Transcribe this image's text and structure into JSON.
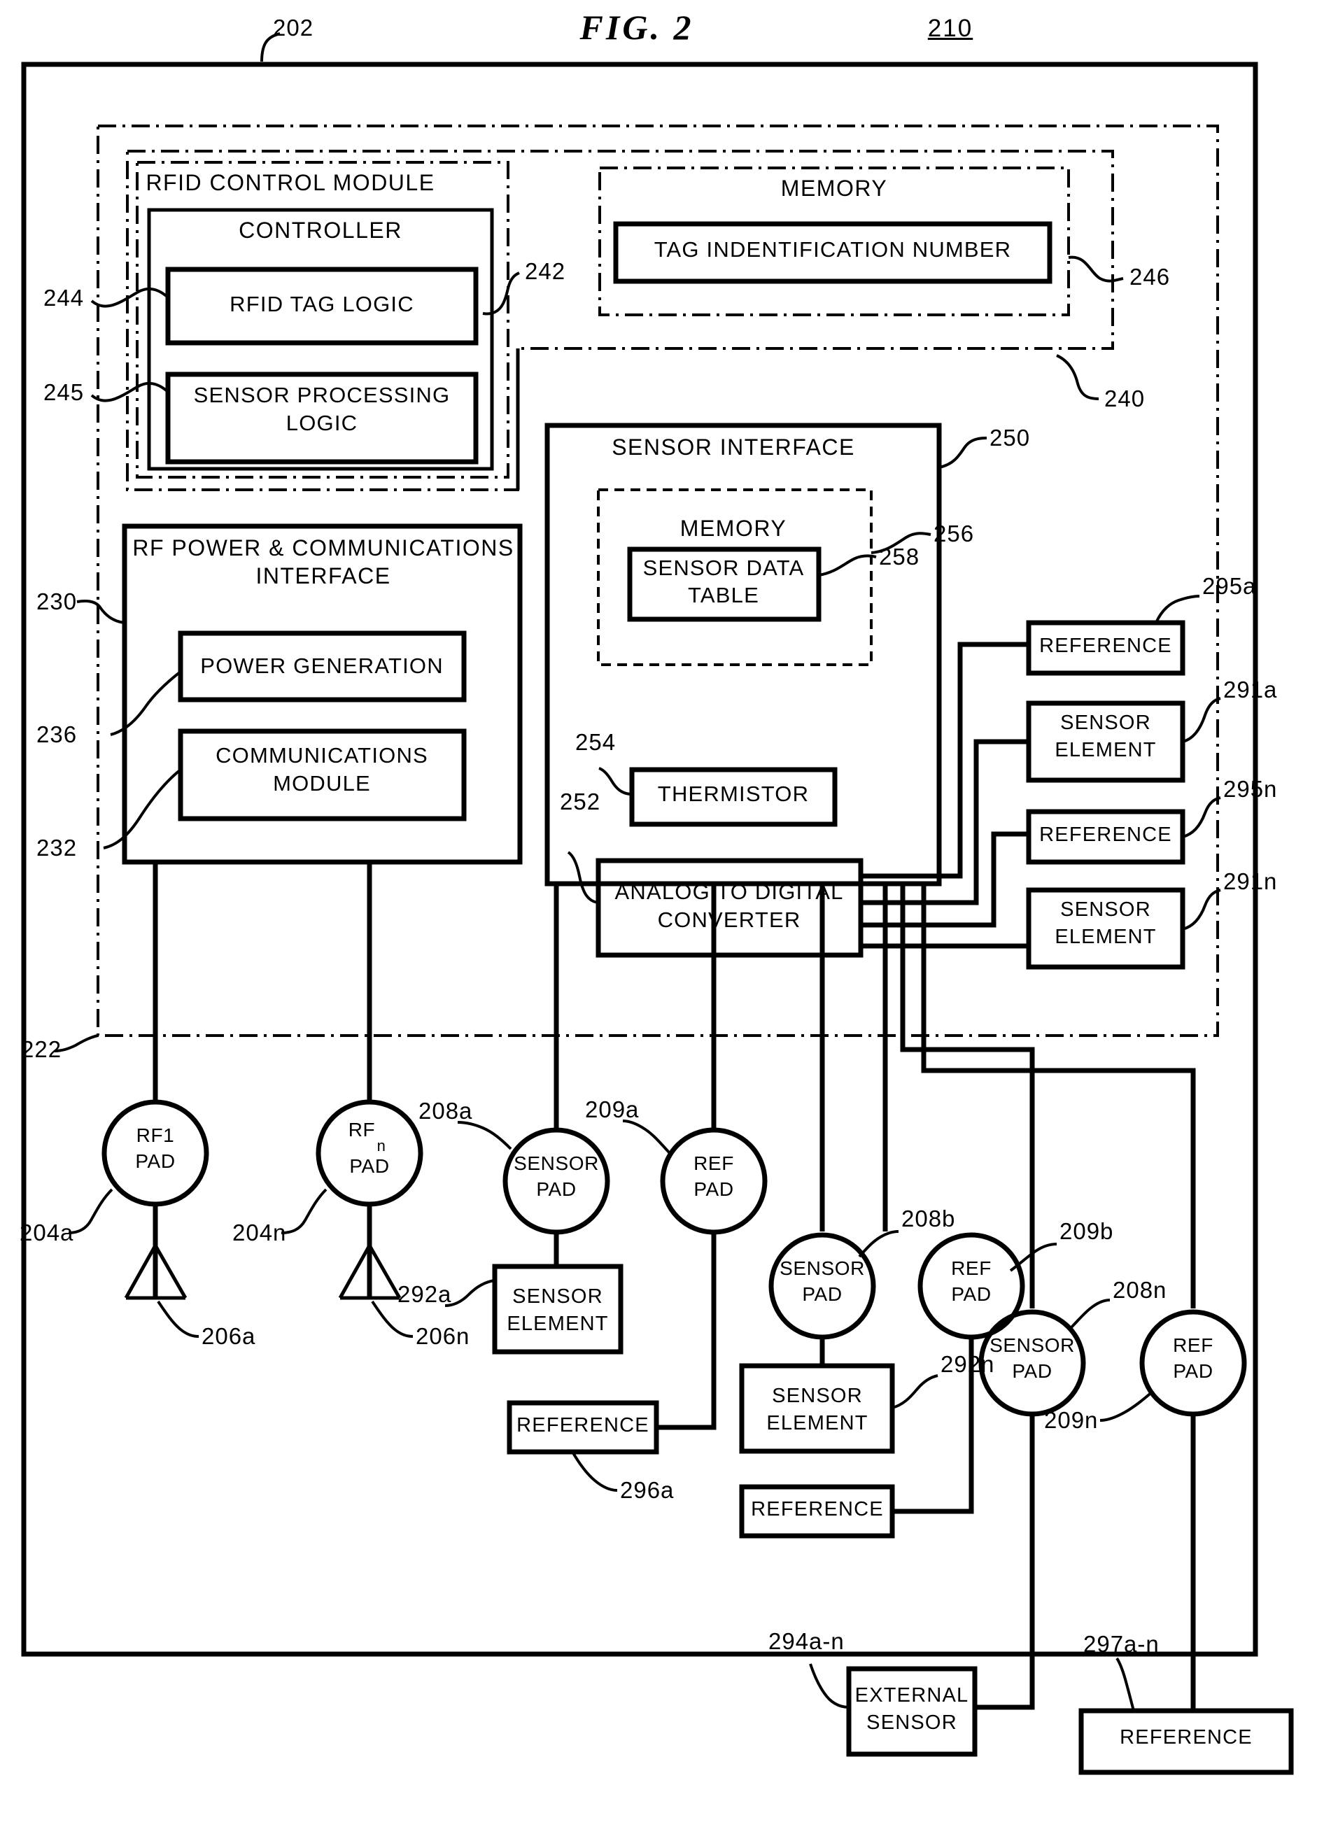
{
  "figure": {
    "title": "FIG. 2",
    "assembly_ref": "210",
    "outer_ref": "202"
  },
  "refs": {
    "r202": "202",
    "r210": "210",
    "r222": "222",
    "r230": "230",
    "r232": "232",
    "r236": "236",
    "r240": "240",
    "r242": "242",
    "r244": "244",
    "r245": "245",
    "r246": "246",
    "r250": "250",
    "r252": "252",
    "r254": "254",
    "r256": "256",
    "r258": "258",
    "r204a": "204a",
    "r204n": "204n",
    "r206a": "206a",
    "r206n": "206n",
    "r208a": "208a",
    "r208b": "208b",
    "r208n": "208n",
    "r209a": "209a",
    "r209b": "209b",
    "r209n": "209n",
    "r291a": "291a",
    "r291n": "291n",
    "r292a": "292a",
    "r292n": "292n",
    "r294an": "294a-n",
    "r295a": "295a",
    "r295n": "295n",
    "r296a": "296a",
    "r297an": "297a-n"
  },
  "blocks": {
    "rfid_control_module": "RFID CONTROL MODULE",
    "controller": "CONTROLLER",
    "rfid_tag_logic": "RFID TAG LOGIC",
    "sensor_processing_logic_l1": "SENSOR PROCESSING",
    "sensor_processing_logic_l2": "LOGIC",
    "memory_top": "MEMORY",
    "tag_identification_number": "TAG INDENTIFICATION NUMBER",
    "rf_power_comms_l1": "RF POWER & COMMUNICATIONS",
    "rf_power_comms_l2": "INTERFACE",
    "power_generation": "POWER GENERATION",
    "communications_module_l1": "COMMUNICATIONS",
    "communications_module_l2": "MODULE",
    "sensor_interface": "SENSOR INTERFACE",
    "memory_sensor": "MEMORY",
    "sensor_data_table_l1": "SENSOR DATA",
    "sensor_data_table_l2": "TABLE",
    "thermistor": "THERMISTOR",
    "adc_l1": "ANALOG TO DIGITAL",
    "adc_l2": "CONVERTER",
    "reference": "REFERENCE",
    "sensor_element_l1": "SENSOR",
    "sensor_element_l2": "ELEMENT",
    "external_sensor_l1": "EXTERNAL",
    "external_sensor_l2": "SENSOR"
  },
  "pads": {
    "rf1_l1": "RF1",
    "rf1_l2": "PAD",
    "rfn_l1": "RF",
    "rfn_sub": "n",
    "rfn_l2": "PAD",
    "sensor_pad_l1": "SENSOR",
    "sensor_pad_l2": "PAD",
    "ref_pad_l1": "REF",
    "ref_pad_l2": "PAD"
  },
  "colors": {
    "ink": "#000000",
    "paper": "#ffffff"
  }
}
